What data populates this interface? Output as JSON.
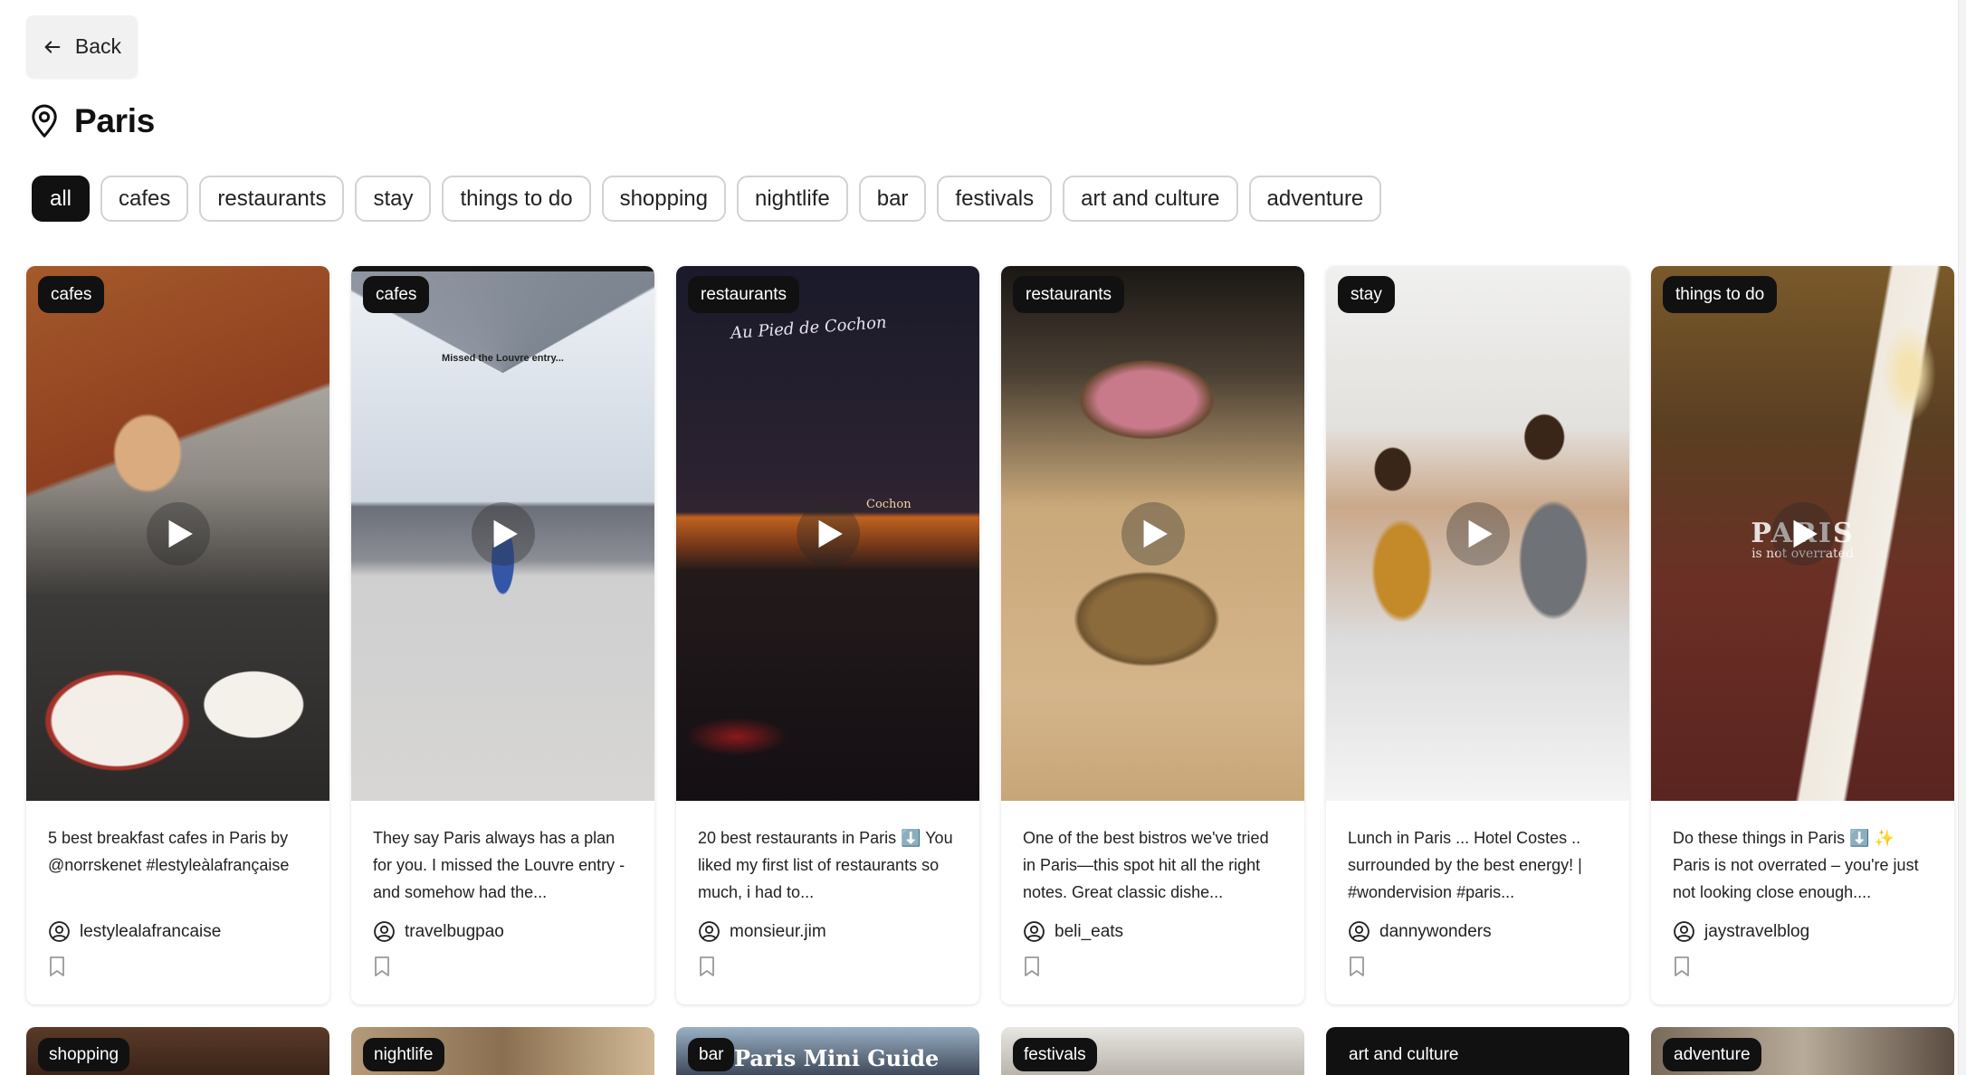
{
  "back": {
    "label": "Back"
  },
  "location": {
    "title": "Paris"
  },
  "filters": [
    "all",
    "cafes",
    "restaurants",
    "stay",
    "things to do",
    "shopping",
    "nightlife",
    "bar",
    "festivals",
    "art and culture",
    "adventure"
  ],
  "active_filter": "all",
  "cards": [
    {
      "category": "cafes",
      "caption": "5 best breakfast cafes in Paris by @norrskenet #lestyleàlafrançaise",
      "author": "lestylealafrancaise"
    },
    {
      "category": "cafes",
      "caption": "They say Paris always has a plan for you. I missed the Louvre entry - and somehow had the...",
      "author": "travelbugpao",
      "overlay": "Missed the Louvre entry..."
    },
    {
      "category": "restaurants",
      "caption": "20 best restaurants in Paris ⬇️ You liked my first list of restaurants so much, i had to...",
      "author": "monsieur.jim",
      "overlay": "Au Pied de Cochon",
      "overlay2": "Cochon"
    },
    {
      "category": "restaurants",
      "caption": "One of the best bistros we've tried in Paris—this spot hit all the right notes. Great classic dishe...",
      "author": "beli_eats"
    },
    {
      "category": "stay",
      "caption": "Lunch in Paris ... Hotel Costes .. surrounded by the best energy! | #wondervision #paris...",
      "author": "dannywonders"
    },
    {
      "category": "things to do",
      "caption": "Do these things in Paris ⬇️ ✨ Paris is not overrated – you're just not looking close enough....",
      "author": "jaystravelblog",
      "overlay": "PARIS",
      "overlay2": "is not overrated"
    }
  ],
  "row2": [
    {
      "category": "shopping"
    },
    {
      "category": "nightlife"
    },
    {
      "category": "bar",
      "overlay": "Paris Mini Guide"
    },
    {
      "category": "festivals"
    },
    {
      "category": "art and culture"
    },
    {
      "category": "adventure"
    }
  ],
  "icons": {
    "back": "arrow-left-icon",
    "location": "map-pin-icon",
    "play": "play-icon",
    "user": "user-circle-icon",
    "bookmark": "bookmark-icon"
  },
  "colors": {
    "active_chip": "#111111",
    "chip_border": "#d2d2d2",
    "back_bg": "#f1f1f1"
  }
}
